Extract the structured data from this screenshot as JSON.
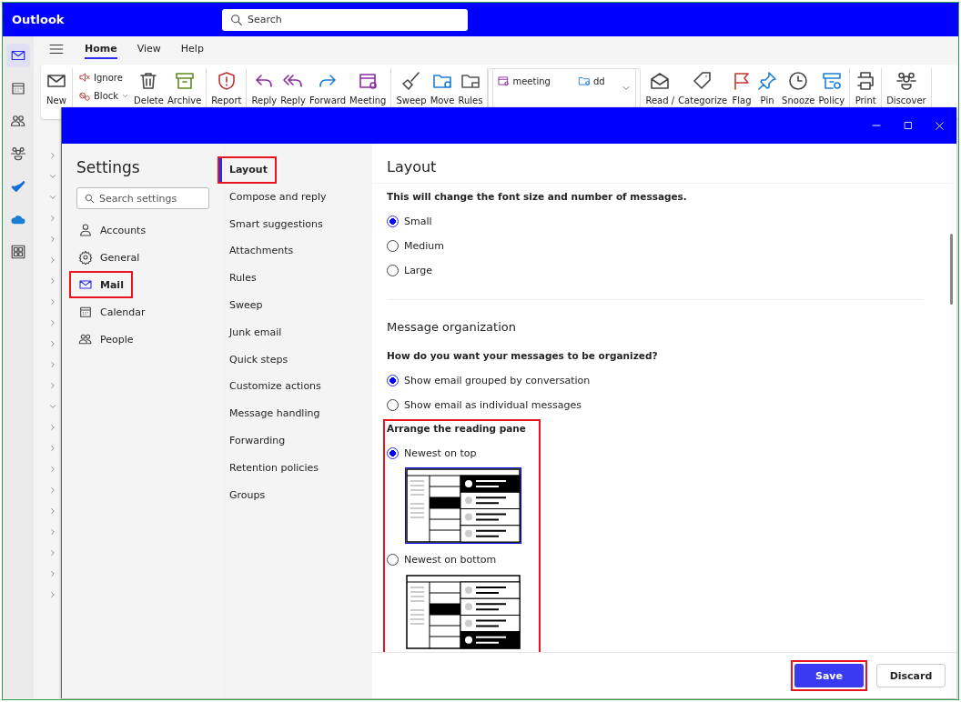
{
  "app": {
    "title": "Outlook"
  },
  "search": {
    "placeholder": "Search"
  },
  "rail": [
    {
      "selected": true
    },
    {
      "selected": false
    },
    {
      "selected": false
    },
    {
      "selected": false
    },
    {
      "selected": false
    },
    {
      "selected": false
    },
    {
      "selected": false
    }
  ],
  "ribbon_tabs": [
    {
      "label": "Home",
      "selected": true
    },
    {
      "label": "View",
      "selected": false
    },
    {
      "label": "Help",
      "selected": false
    }
  ],
  "ribbon_groups": [
    {
      "kind": "buttons",
      "buttons": [
        {
          "label": "New",
          "kind": "large",
          "dropdown": false
        }
      ]
    },
    {
      "kind": "buttons",
      "buttons": [
        {
          "label": "Ignore",
          "kind": "small",
          "dropdown": false
        },
        {
          "label": "Block",
          "kind": "small",
          "dropdown": true
        },
        {
          "label": "Delete",
          "kind": "large",
          "dropdown": false
        },
        {
          "label": "Archive",
          "kind": "large",
          "dropdown": false
        }
      ]
    },
    {
      "kind": "buttons",
      "buttons": [
        {
          "label": "Report",
          "kind": "large",
          "dropdown": false
        }
      ]
    },
    {
      "kind": "buttons",
      "buttons": [
        {
          "label": "Reply",
          "kind": "large",
          "dropdown": false
        },
        {
          "label": "Reply",
          "kind": "large",
          "dropdown": false
        },
        {
          "label": "Forward",
          "kind": "large",
          "dropdown": false
        },
        {
          "label": "Meeting",
          "kind": "large",
          "dropdown": false
        }
      ]
    },
    {
      "kind": "buttons",
      "buttons": [
        {
          "label": "Sweep",
          "kind": "large",
          "dropdown": false
        },
        {
          "label": "Move",
          "kind": "large",
          "dropdown": false
        },
        {
          "label": "Rules",
          "kind": "large",
          "dropdown": false
        }
      ]
    },
    {
      "kind": "gallery",
      "items": [
        "meeting",
        "dd"
      ]
    },
    {
      "kind": "buttons",
      "buttons": [
        {
          "label": "Read /",
          "kind": "large",
          "dropdown": false
        },
        {
          "label": "Categorize",
          "kind": "large",
          "dropdown": false
        },
        {
          "label": "Flag",
          "kind": "large",
          "dropdown": false
        },
        {
          "label": "Pin",
          "kind": "large",
          "dropdown": false
        },
        {
          "label": "Snooze",
          "kind": "large",
          "dropdown": false
        },
        {
          "label": "Policy",
          "kind": "large",
          "dropdown": false
        }
      ]
    },
    {
      "kind": "buttons",
      "buttons": [
        {
          "label": "Print",
          "kind": "large",
          "dropdown": false
        }
      ]
    },
    {
      "kind": "buttons",
      "buttons": [
        {
          "label": "Discover",
          "kind": "large",
          "dropdown": false
        }
      ]
    }
  ],
  "settings": {
    "title": "Settings",
    "search_placeholder": "Search settings",
    "nav": [
      {
        "label": "Accounts",
        "selected": false,
        "highlighted": false
      },
      {
        "label": "General",
        "selected": false,
        "highlighted": false
      },
      {
        "label": "Mail",
        "selected": true,
        "highlighted": true
      },
      {
        "label": "Calendar",
        "selected": false,
        "highlighted": false
      },
      {
        "label": "People",
        "selected": false,
        "highlighted": false
      }
    ],
    "subnav": [
      {
        "label": "Layout",
        "selected": true,
        "highlighted": true
      },
      {
        "label": "Compose and reply",
        "selected": false,
        "highlighted": false
      },
      {
        "label": "Smart suggestions",
        "selected": false,
        "highlighted": false
      },
      {
        "label": "Attachments",
        "selected": false,
        "highlighted": false
      },
      {
        "label": "Rules",
        "selected": false,
        "highlighted": false
      },
      {
        "label": "Sweep",
        "selected": false,
        "highlighted": false
      },
      {
        "label": "Junk email",
        "selected": false,
        "highlighted": false
      },
      {
        "label": "Quick steps",
        "selected": false,
        "highlighted": false
      },
      {
        "label": "Customize actions",
        "selected": false,
        "highlighted": false
      },
      {
        "label": "Message handling",
        "selected": false,
        "highlighted": false
      },
      {
        "label": "Forwarding",
        "selected": false,
        "highlighted": false
      },
      {
        "label": "Retention policies",
        "selected": false,
        "highlighted": false
      },
      {
        "label": "Groups",
        "selected": false,
        "highlighted": false
      }
    ],
    "page_title": "Layout",
    "sections": [
      {
        "kind": "radio",
        "question": "This will change the font size and number of messages.",
        "highlighted": false,
        "divider_after": true,
        "options": [
          {
            "label": "Small",
            "selected": true
          },
          {
            "label": "Medium",
            "selected": false
          },
          {
            "label": "Large",
            "selected": false
          }
        ]
      },
      {
        "kind": "radio",
        "heading": "Message organization",
        "question": "How do you want your messages to be organized?",
        "highlighted": false,
        "divider_after": false,
        "options": [
          {
            "label": "Show email grouped by conversation",
            "selected": true
          },
          {
            "label": "Show email as individual messages",
            "selected": false
          }
        ]
      },
      {
        "kind": "radio_preview",
        "question": "Arrange the reading pane",
        "highlighted": true,
        "divider_after": false,
        "options": [
          {
            "label": "Newest on top",
            "selected": true
          },
          {
            "label": "Newest on bottom",
            "selected": false
          }
        ]
      }
    ],
    "buttons": [
      {
        "label": "Save",
        "kind": "primary",
        "highlighted": true
      },
      {
        "label": "Discard",
        "kind": "secondary",
        "highlighted": false
      }
    ]
  }
}
